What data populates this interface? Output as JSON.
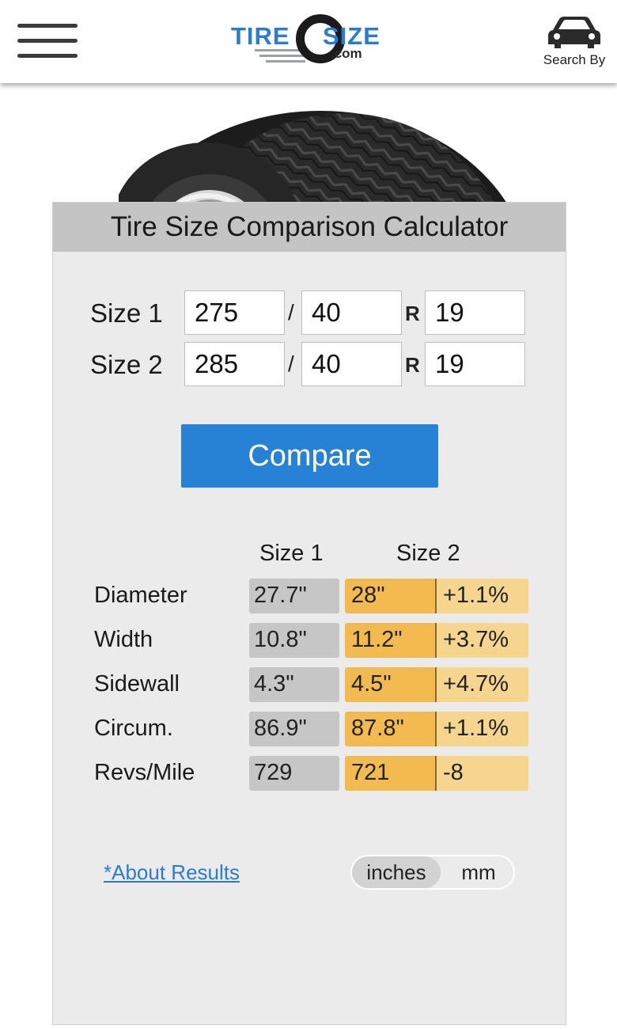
{
  "header": {
    "logo": {
      "part1": "TIRE",
      "part2": "SIZE",
      "part3": ".com"
    },
    "search_by_label": "Search By"
  },
  "calculator": {
    "title": "Tire Size Comparison Calculator",
    "size1": {
      "label": "Size 1",
      "width": "275",
      "aspect": "40",
      "rim": "19"
    },
    "size2": {
      "label": "Size 2",
      "width": "285",
      "aspect": "40",
      "rim": "19"
    },
    "separator_slash": "/",
    "separator_r": "R",
    "compare_label": "Compare"
  },
  "results": {
    "col1": "Size 1",
    "col2": "Size 2",
    "rows": [
      {
        "name": "Diameter",
        "size1": "27.7\"",
        "size2": "28\"",
        "diff": "+1.1%"
      },
      {
        "name": "Width",
        "size1": "10.8\"",
        "size2": "11.2\"",
        "diff": "+3.7%"
      },
      {
        "name": "Sidewall",
        "size1": "4.3\"",
        "size2": "4.5\"",
        "diff": "+4.7%"
      },
      {
        "name": "Circum.",
        "size1": "86.9\"",
        "size2": "87.8\"",
        "diff": "+1.1%"
      },
      {
        "name": "Revs/Mile",
        "size1": "729",
        "size2": "721",
        "diff": "-8"
      }
    ]
  },
  "footer": {
    "about_link": "*About Results",
    "units": {
      "inches": "inches",
      "mm": "mm",
      "selected": "inches"
    }
  },
  "colors": {
    "brand_blue": "#2781d5",
    "size2_highlight": "#f3bb4f",
    "diff_highlight": "#f6d58f",
    "size1_cell": "#c6c6c6"
  }
}
